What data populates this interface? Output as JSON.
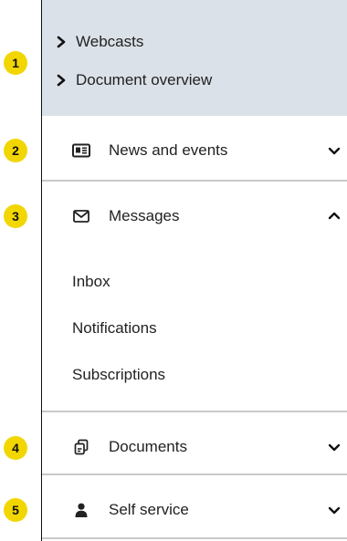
{
  "badges": [
    "1",
    "2",
    "3",
    "4",
    "5"
  ],
  "submenu": {
    "items": [
      "Webcasts",
      "Document overview"
    ]
  },
  "sections": {
    "news": {
      "label": "News and events",
      "icon": "newspaper-icon",
      "state": "collapsed"
    },
    "messages": {
      "label": "Messages",
      "icon": "envelope-icon",
      "state": "expanded",
      "children": [
        "Inbox",
        "Notifications",
        "Subscriptions"
      ]
    },
    "documents": {
      "label": "Documents",
      "icon": "documents-icon",
      "state": "collapsed"
    },
    "self_service": {
      "label": "Self service",
      "icon": "person-icon",
      "state": "collapsed"
    }
  },
  "colors": {
    "badge": "#f2d600",
    "submenu_bg": "#dbe1e8",
    "divider": "#c9c9c9"
  }
}
